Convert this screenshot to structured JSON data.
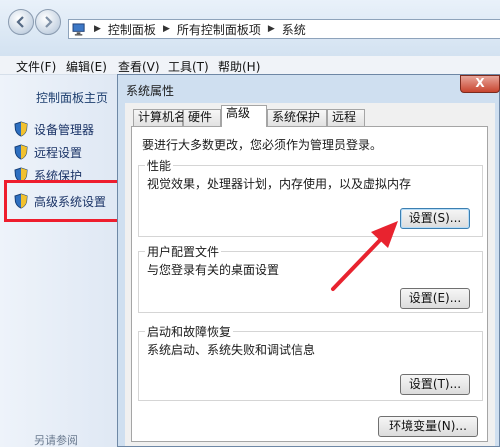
{
  "address_bar": {
    "crumbs": [
      "控制面板",
      "所有控制面板项",
      "系统"
    ]
  },
  "menu": {
    "items": [
      "文件(F)",
      "编辑(E)",
      "查看(V)",
      "工具(T)",
      "帮助(H)"
    ]
  },
  "left_pane": {
    "home": "控制面板主页",
    "items": [
      "设备管理器",
      "远程设置",
      "系统保护",
      "高级系统设置"
    ],
    "see_also": "另请参阅"
  },
  "dialog": {
    "title": "系统属性",
    "close_glyph": "X",
    "tabs": [
      "计算机名",
      "硬件",
      "高级",
      "系统保护",
      "远程"
    ],
    "active_tab": "高级",
    "admin_note": "要进行大多数更改，您必须作为管理员登录。",
    "groups": {
      "performance": {
        "title": "性能",
        "desc": "视觉效果，处理器计划，内存使用，以及虚拟内存",
        "button": "设置(S)..."
      },
      "profiles": {
        "title": "用户配置文件",
        "desc": "与您登录有关的桌面设置",
        "button": "设置(E)..."
      },
      "startup": {
        "title": "启动和故障恢复",
        "desc": "系统启动、系统失败和调试信息",
        "button": "设置(T)..."
      }
    },
    "env_button": "环境变量(N)..."
  },
  "colors": {
    "highlight_box": "#ee1d2d",
    "annotation_arrow": "#e8232f"
  }
}
